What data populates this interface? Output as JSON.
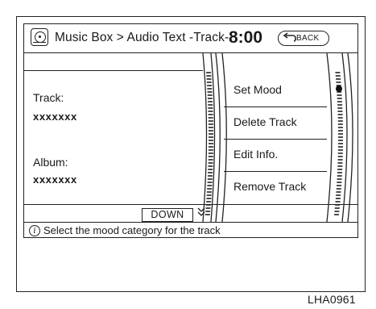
{
  "header": {
    "breadcrumb": "Music Box > Audio Text -Track-",
    "clock": "8:00",
    "back_label": "BACK"
  },
  "info_panel": {
    "track_label": "Track:",
    "track_value": "xxxxxxx",
    "album_label": "Album:",
    "album_value": "xxxxxxx",
    "down_label": "DOWN"
  },
  "menu": {
    "items": [
      {
        "label": "Set Mood",
        "selected": true
      },
      {
        "label": "Delete Track",
        "selected": false
      },
      {
        "label": "Edit Info.",
        "selected": false
      },
      {
        "label": "Remove Track",
        "selected": false
      }
    ]
  },
  "status": {
    "icon": "info-icon",
    "text": "Select the mood category for the track"
  },
  "figure_code": "LHA0961"
}
